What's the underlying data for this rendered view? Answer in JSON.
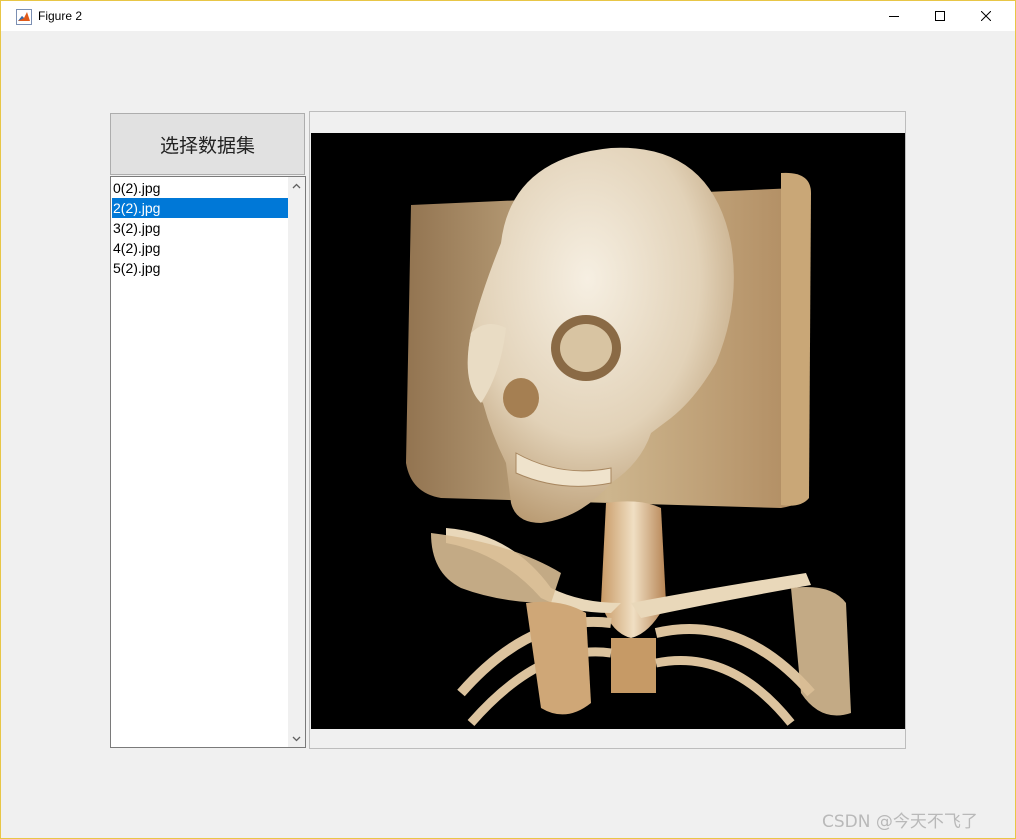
{
  "window": {
    "title": "Figure 2",
    "icon": "matlab-icon",
    "controls": {
      "minimize_icon": "minimize-icon",
      "maximize_icon": "maximize-icon",
      "close_icon": "close-icon"
    }
  },
  "panel": {
    "button_label": "选择数据集",
    "files": [
      "0(2).jpg",
      "2(2).jpg",
      "3(2).jpg",
      "4(2).jpg",
      "5(2).jpg"
    ],
    "selected_file": "2(2).jpg"
  },
  "viewer": {
    "image_description": "skull-ct-volume-render",
    "background_color": "#000000"
  },
  "watermark": "CSDN @今天不飞了",
  "colors": {
    "selection": "#0078d7",
    "window_border": "#e8c646"
  }
}
